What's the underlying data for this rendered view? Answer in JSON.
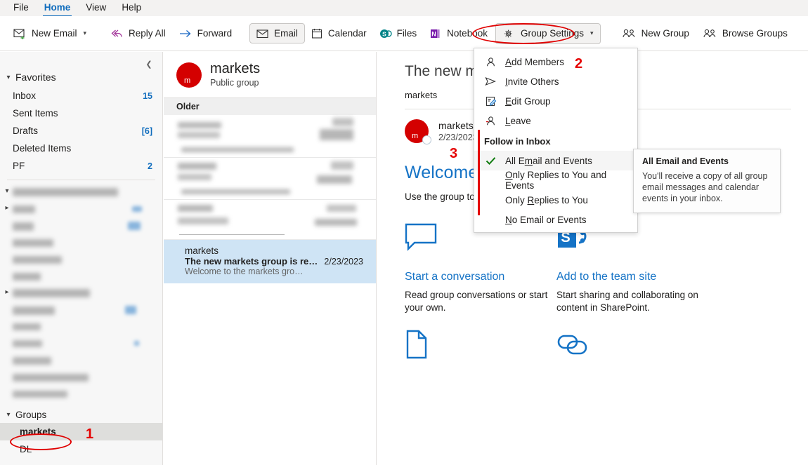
{
  "menubar": {
    "items": [
      {
        "label": "File",
        "active": false
      },
      {
        "label": "Home",
        "active": true
      },
      {
        "label": "View",
        "active": false
      },
      {
        "label": "Help",
        "active": false
      }
    ]
  },
  "ribbon": {
    "new_email": "New Email",
    "reply_all": "Reply All",
    "forward": "Forward",
    "email": "Email",
    "calendar": "Calendar",
    "files": "Files",
    "notebook": "Notebook",
    "group_settings": "Group Settings",
    "new_group": "New Group",
    "browse_groups": "Browse Groups",
    "overflow": "•••"
  },
  "sidebar": {
    "favorites_label": "Favorites",
    "favorites": [
      {
        "label": "Inbox",
        "count": "15"
      },
      {
        "label": "Sent Items",
        "count": ""
      },
      {
        "label": "Drafts",
        "count": "[6]"
      },
      {
        "label": "Deleted Items",
        "count": ""
      },
      {
        "label": "PF",
        "count": "2"
      }
    ],
    "groups_label": "Groups",
    "groups": [
      {
        "label": "markets",
        "selected": true
      },
      {
        "label": "DL",
        "selected": false
      }
    ]
  },
  "group_header": {
    "initial": "m",
    "name": "markets",
    "privacy": "Public group"
  },
  "message_list": {
    "section_label": "Older",
    "selected_message": {
      "from": "markets",
      "subject": "The new markets group is re…",
      "date": "2/23/2023",
      "preview": "Welcome to the markets gro…"
    }
  },
  "reading_pane": {
    "subject": "The new ma",
    "group_line": "markets",
    "sender_initial": "m",
    "sender_name": "markets",
    "sender_date": "2/23/2023",
    "welcome_title": "Welcome to the markets group.",
    "welcome_subtitle": "Use the group to share ideas, files, and important dates.",
    "cards": [
      {
        "icon": "conversation-icon",
        "title": "Start a conversation",
        "body": "Read group conversations or start your own."
      },
      {
        "icon": "sharepoint-icon",
        "title": "Add to the team site",
        "body": "Start sharing and collaborating on content in SharePoint."
      }
    ],
    "cards_row2": [
      {
        "icon": "document-icon"
      },
      {
        "icon": "link-icon"
      }
    ]
  },
  "dropdown": {
    "items": [
      {
        "label_pre": "",
        "accel": "A",
        "label_post": "dd Members",
        "icon": "person-icon"
      },
      {
        "label_pre": "",
        "accel": "I",
        "label_post": "nvite Others",
        "icon": "send-icon"
      },
      {
        "label_pre": "",
        "accel": "E",
        "label_post": "dit Group",
        "icon": "edit-group-icon"
      },
      {
        "label_pre": "",
        "accel": "L",
        "label_post": "eave",
        "icon": "person-leave-icon"
      }
    ],
    "section_label": "Follow in Inbox",
    "follow_items": [
      {
        "label_pre": "All E",
        "accel": "m",
        "label_post": "ail and Events",
        "checked": true
      },
      {
        "label_pre": "",
        "accel": "O",
        "label_post": "nly Replies to You and Events",
        "checked": false
      },
      {
        "label_pre": "Only ",
        "accel": "R",
        "label_post": "eplies to You",
        "checked": false
      },
      {
        "label_pre": "",
        "accel": "N",
        "label_post": "o Email or Events",
        "checked": false
      }
    ]
  },
  "tooltip": {
    "title": "All Email and Events",
    "body": "You'll receive a copy of all group email messages and calendar events in your inbox."
  },
  "annotations": [
    {
      "number": "1",
      "target": "markets-group-sidebar"
    },
    {
      "number": "2",
      "target": "group-settings-menu"
    },
    {
      "number": "3",
      "target": "reading-pane"
    }
  ],
  "colors": {
    "accent": "#0f6cbd",
    "link": "#1573c6",
    "avatar": "#d40000",
    "annotation": "#e50000",
    "selection": "#cfe4f5",
    "check": "#107c10"
  }
}
